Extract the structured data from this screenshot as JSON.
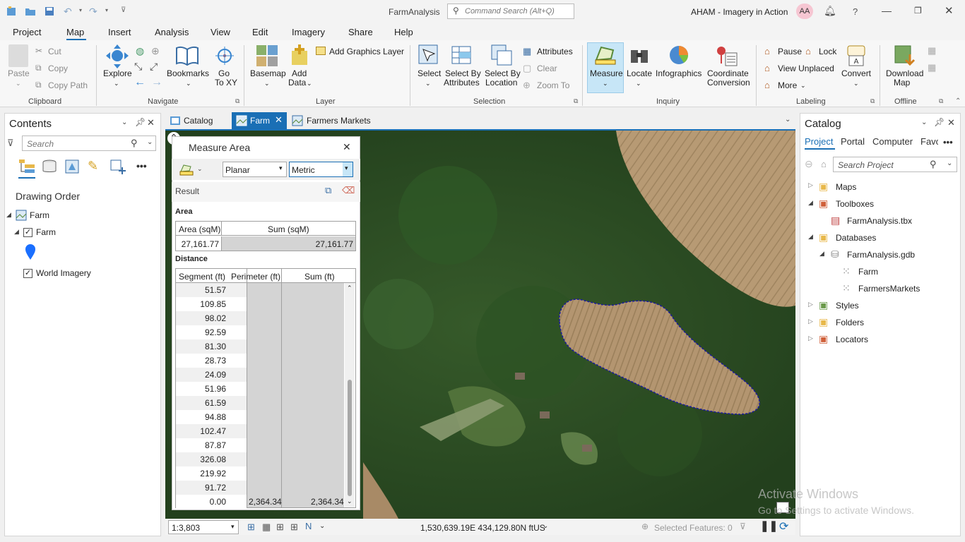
{
  "title": {
    "app_name": "FarmAnalysis",
    "search_placeholder": "Command Search (Alt+Q)",
    "project_name": "AHAM - Imagery in Action",
    "user_initials": "AA"
  },
  "menu": [
    "Project",
    "Map",
    "Insert",
    "Analysis",
    "View",
    "Edit",
    "Imagery",
    "Share",
    "Help"
  ],
  "ribbon": {
    "clipboard": {
      "paste": "Paste",
      "cut": "Cut",
      "copy": "Copy",
      "copy_path": "Copy Path",
      "group": "Clipboard"
    },
    "navigate": {
      "explore": "Explore",
      "bookmarks": "Bookmarks",
      "go_to_xy_1": "Go",
      "go_to_xy_2": "To XY",
      "group": "Navigate"
    },
    "layer": {
      "basemap": "Basemap",
      "add_data_1": "Add",
      "add_data_2": "Data",
      "add_graphics": "Add Graphics Layer",
      "group": "Layer"
    },
    "selection": {
      "select": "Select",
      "sba_1": "Select By",
      "sba_2": "Attributes",
      "sbl_1": "Select By",
      "sbl_2": "Location",
      "attributes": "Attributes",
      "clear": "Clear",
      "zoom_to": "Zoom To",
      "group": "Selection"
    },
    "inquiry": {
      "measure": "Measure",
      "locate": "Locate",
      "infographics": "Infographics",
      "cc_1": "Coordinate",
      "cc_2": "Conversion",
      "group": "Inquiry"
    },
    "labeling": {
      "pause": "Pause",
      "lock": "Lock",
      "view_unplaced": "View Unplaced",
      "more": "More",
      "convert": "Convert",
      "group": "Labeling"
    },
    "offline": {
      "download_1": "Download",
      "download_2": "Map",
      "group": "Offline"
    }
  },
  "contents": {
    "title": "Contents",
    "search_placeholder": "Search",
    "drawing_order": "Drawing Order",
    "map_name": "Farm",
    "layer_farm": "Farm",
    "layer_imagery": "World Imagery"
  },
  "tabs": [
    "Catalog",
    "Farm",
    "Farmers Markets"
  ],
  "measure": {
    "title": "Measure Area",
    "mode": "Planar",
    "units": "Metric",
    "result_label": "Result",
    "area_label": "Area",
    "area_headers": [
      "Area (sqM)",
      "Sum (sqM)"
    ],
    "area_values": [
      "27,161.77",
      "27,161.77"
    ],
    "distance_label": "Distance",
    "distance_headers": [
      "Segment (ft)",
      "Perimeter (ft)",
      "Sum (ft)"
    ],
    "segments": [
      "51.57",
      "109.85",
      "98.02",
      "92.59",
      "81.30",
      "28.73",
      "24.09",
      "51.96",
      "61.59",
      "94.88",
      "102.47",
      "87.87",
      "326.08",
      "219.92",
      "91.72",
      "0.00"
    ],
    "perimeter_total": "2,364.34",
    "sum_total": "2,364.34"
  },
  "catalog": {
    "title": "Catalog",
    "tabs": [
      "Project",
      "Portal",
      "Computer",
      "Favo"
    ],
    "search_placeholder": "Search Project",
    "items": {
      "maps": "Maps",
      "toolboxes": "Toolboxes",
      "tbx": "FarmAnalysis.tbx",
      "databases": "Databases",
      "gdb": "FarmAnalysis.gdb",
      "fc_farm": "Farm",
      "fc_markets": "FarmersMarkets",
      "styles": "Styles",
      "folders": "Folders",
      "locators": "Locators"
    }
  },
  "status": {
    "scale": "1:3,803",
    "coords": "1,530,639.19E 434,129.80N ftUS",
    "selected": "Selected Features: 0"
  },
  "watermark": {
    "line1": "Activate Windows",
    "line2": "Go to Settings to activate Windows."
  },
  "colors": {
    "accent": "#1a6fb5",
    "measure_bg": "#c7e6f7",
    "tab_active": "#dce9f5"
  }
}
